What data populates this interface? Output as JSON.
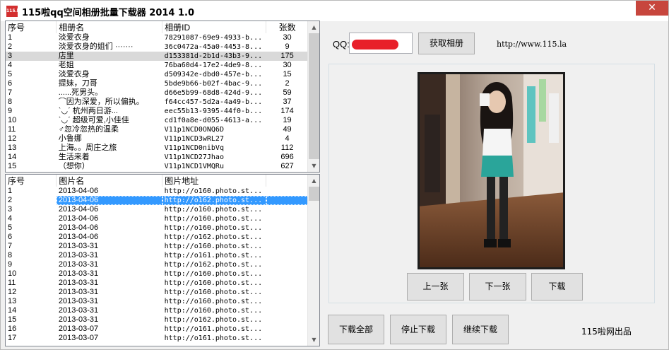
{
  "window": {
    "title": "115啦qq空间相册批量下载器 2014 1.0",
    "icon_label": "115.la",
    "close_symbol": "✕"
  },
  "albums": {
    "columns": [
      "序号",
      "相册名",
      "相册ID",
      "张数"
    ],
    "rows": [
      [
        "1",
        "淡爱衣身",
        "78291087-69e9-4933-b...",
        "30"
      ],
      [
        "2",
        "淡爱衣身的姐们 ·······",
        "36c0472a-45a0-4453-8...",
        "9"
      ],
      [
        "3",
        "店里",
        "d153381d-2b1d-43b3-9...",
        "175"
      ],
      [
        "4",
        "老姐",
        "76ba60d4-17e2-4de9-8...",
        "30"
      ],
      [
        "5",
        "淡爱衣身",
        "d509342e-dbd0-457e-b...",
        "15"
      ],
      [
        "6",
        "提妹，刀哥",
        "5bde9b66-b02f-4bac-9...",
        "2"
      ],
      [
        "7",
        "......死男头。",
        "d66e5b99-68d8-424d-9...",
        "59"
      ],
      [
        "8",
        "⌒因为深爱，所以偏执。",
        "f64cc457-5d2a-4a49-b...",
        "37"
      ],
      [
        "9",
        "ˋ◡ˊ 杭州两日游...",
        "eec55b13-9395-44f0-b...",
        "174"
      ],
      [
        "10",
        "ˋ◡ˊ 超级可爱,小佳佳",
        "cd1f0a8e-d055-4613-a...",
        "19"
      ],
      [
        "11",
        "♂忽冷忽热的温柔",
        "V11p1NCD0ONQ6D",
        "49"
      ],
      [
        "12",
        "小鲁娜",
        "V11p1NCD3wRL27",
        "4"
      ],
      [
        "13",
        "上海。。周庄之旅",
        "V11p1NCD0nibVq",
        "112"
      ],
      [
        "14",
        "生活来着",
        "V11p1NCD27Jhao",
        "696"
      ],
      [
        "15",
        "（想你）",
        "V11p1NCD1VMQRu",
        "627"
      ]
    ]
  },
  "photos": {
    "columns": [
      "序号",
      "图片名",
      "图片地址"
    ],
    "rows": [
      [
        "1",
        "2013-04-06",
        "http://o160.photo.st..."
      ],
      [
        "2",
        "2013-04-06",
        "http://o162.photo.st..."
      ],
      [
        "3",
        "2013-04-06",
        "http://o160.photo.st..."
      ],
      [
        "4",
        "2013-04-06",
        "http://o160.photo.st..."
      ],
      [
        "5",
        "2013-04-06",
        "http://o160.photo.st..."
      ],
      [
        "6",
        "2013-04-06",
        "http://o162.photo.st..."
      ],
      [
        "7",
        "2013-03-31",
        "http://o160.photo.st..."
      ],
      [
        "8",
        "2013-03-31",
        "http://o161.photo.st..."
      ],
      [
        "9",
        "2013-03-31",
        "http://o162.photo.st..."
      ],
      [
        "10",
        "2013-03-31",
        "http://o160.photo.st..."
      ],
      [
        "11",
        "2013-03-31",
        "http://o160.photo.st..."
      ],
      [
        "12",
        "2013-03-31",
        "http://o160.photo.st..."
      ],
      [
        "13",
        "2013-03-31",
        "http://o160.photo.st..."
      ],
      [
        "14",
        "2013-03-31",
        "http://o160.photo.st..."
      ],
      [
        "15",
        "2013-03-31",
        "http://o162.photo.st..."
      ],
      [
        "16",
        "2013-03-07",
        "http://o161.photo.st..."
      ],
      [
        "17",
        "2013-03-07",
        "http://o161.photo.st..."
      ]
    ],
    "selected_row_number": "2"
  },
  "qq": {
    "label": "QQ:",
    "value": "",
    "fetch_button": "获取相册",
    "url": "http://www.115.la"
  },
  "viewer": {
    "prev_button": "上一张",
    "next_button": "下一张",
    "download_button": "下载"
  },
  "footer": {
    "download_all_button": "下载全部",
    "stop_button": "停止下载",
    "resume_button": "继续下载",
    "credit": "115啦网出品"
  },
  "colors": {
    "selection": "#3399ff",
    "redaction": "#e8202a",
    "close_button": "#c7463d"
  },
  "icons": {
    "scroll_up": "▲",
    "scroll_down": "▼"
  }
}
